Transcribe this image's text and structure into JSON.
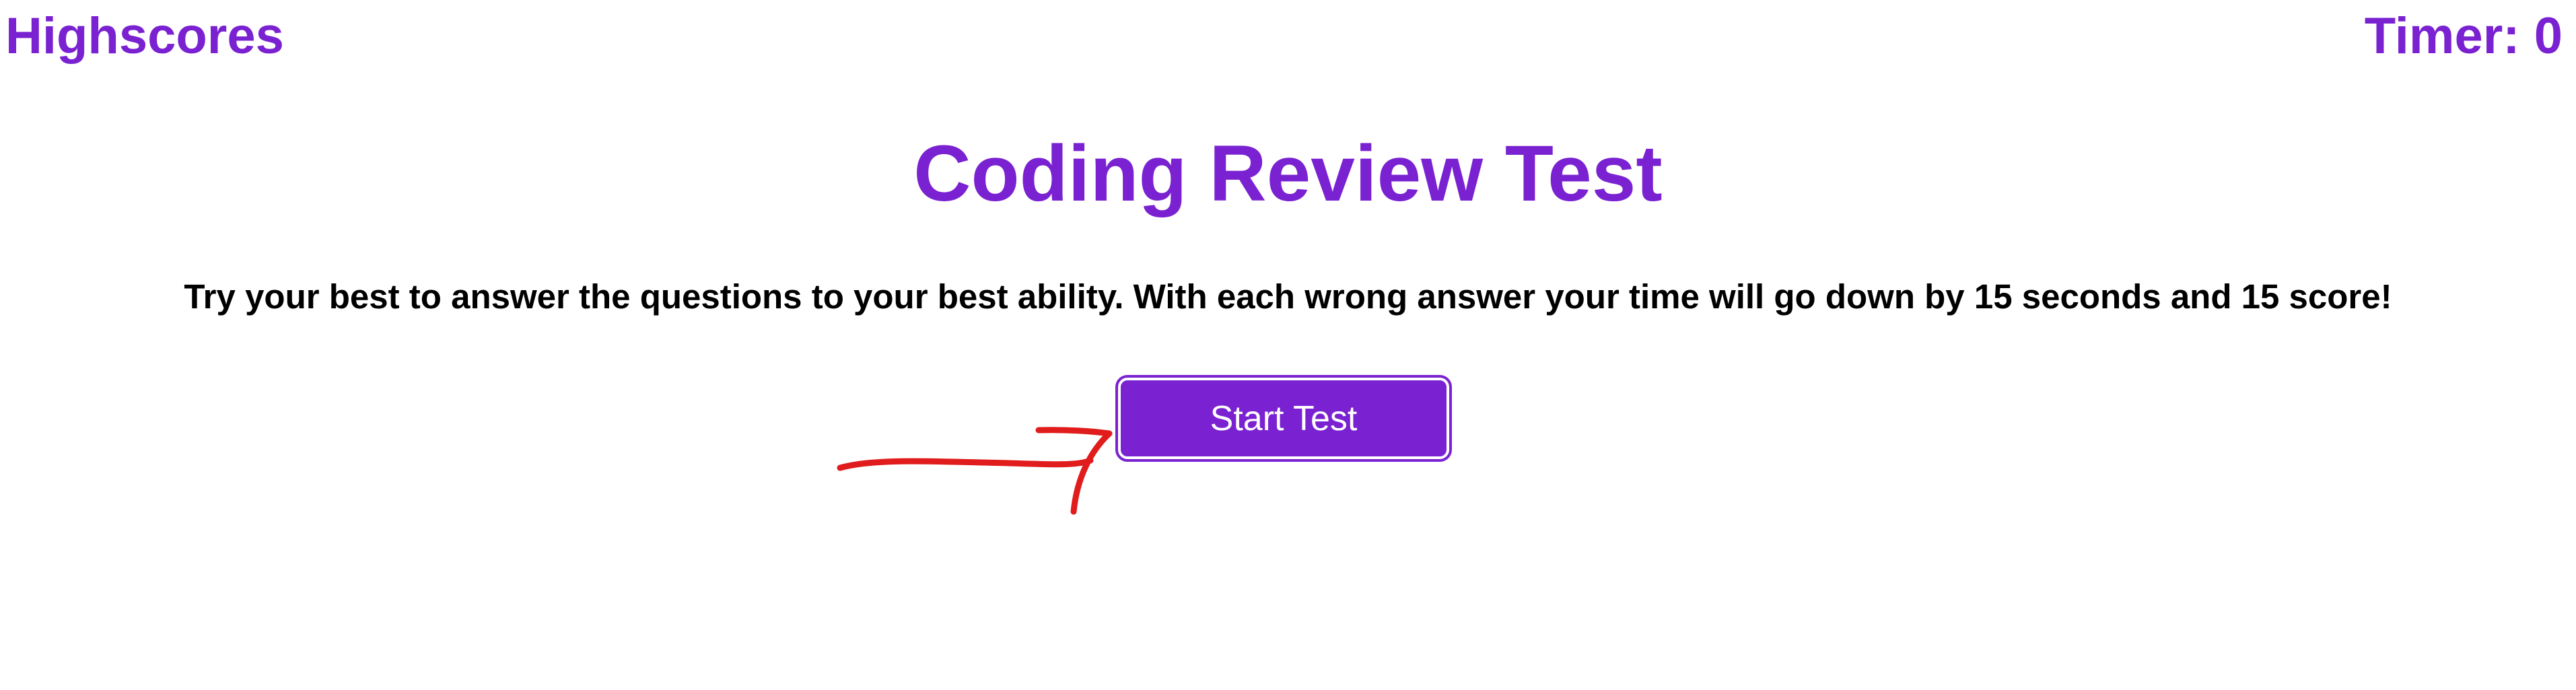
{
  "header": {
    "highscores_label": "Highscores",
    "timer_text": "Timer: 0"
  },
  "main": {
    "title": "Coding Review Test",
    "instructions": "Try your best to answer the questions to your best ability. With each wrong answer your time will go down by 15 seconds and 15 score!",
    "start_button_label": "Start Test"
  },
  "annotation": {
    "arrow_color": "#e01c1c",
    "icon": "hand-drawn-arrow-icon"
  },
  "colors": {
    "accent": "#7a22d1",
    "text": "#000000",
    "background": "#ffffff"
  }
}
